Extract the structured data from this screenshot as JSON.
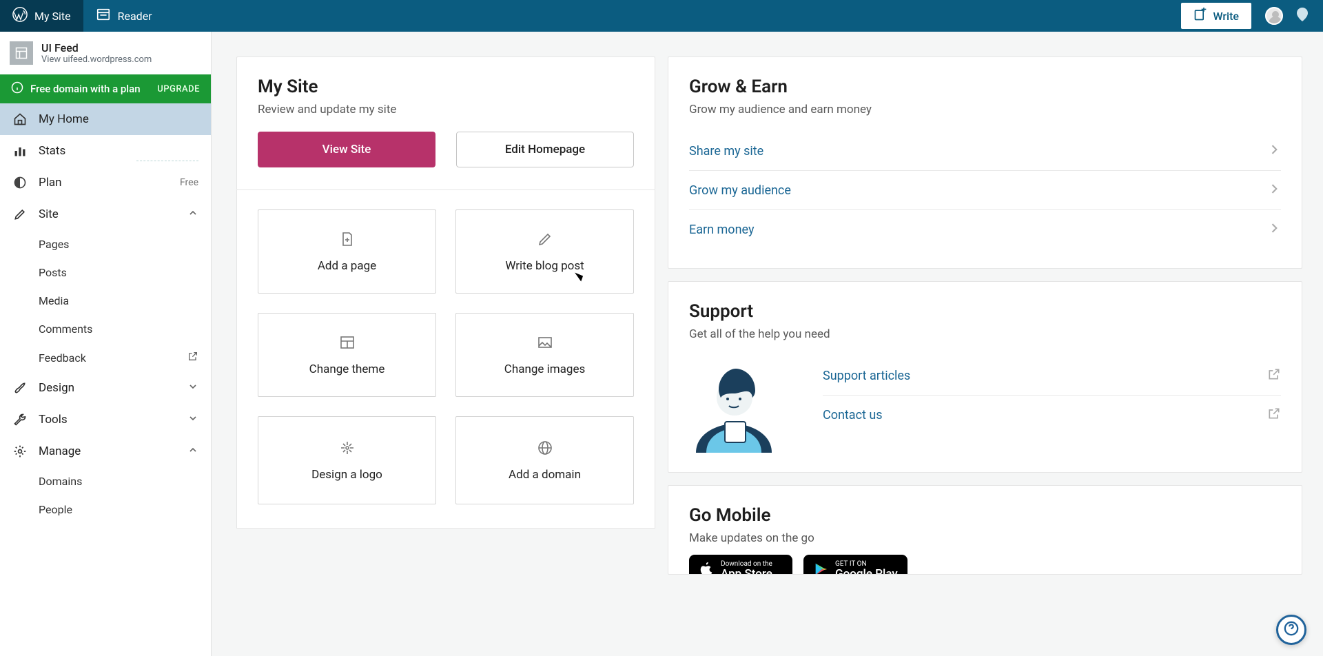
{
  "topbar": {
    "my_site": "My Site",
    "reader": "Reader",
    "write": "Write"
  },
  "sidebar": {
    "site_name": "UI Feed",
    "site_sub": "View uifeed.wordpress.com",
    "upgrade_label": "Free domain with a plan",
    "upgrade_cta": "UPGRADE",
    "nav": {
      "home": "My Home",
      "stats": "Stats",
      "plan": "Plan",
      "plan_extra": "Free",
      "site": "Site",
      "design": "Design",
      "tools": "Tools",
      "manage": "Manage"
    },
    "site_sub_items": [
      "Pages",
      "Posts",
      "Media",
      "Comments",
      "Feedback"
    ],
    "manage_sub_items": [
      "Domains",
      "People"
    ]
  },
  "mysite_card": {
    "title": "My Site",
    "desc": "Review and update my site",
    "view_btn": "View Site",
    "edit_btn": "Edit Homepage",
    "tiles": [
      "Add a page",
      "Write blog post",
      "Change theme",
      "Change images",
      "Design a logo",
      "Add a domain"
    ]
  },
  "grow_card": {
    "title": "Grow & Earn",
    "desc": "Grow my audience and earn money",
    "links": [
      "Share my site",
      "Grow my audience",
      "Earn money"
    ]
  },
  "support_card": {
    "title": "Support",
    "desc": "Get all of the help you need",
    "links": [
      "Support articles",
      "Contact us"
    ]
  },
  "mobile_card": {
    "title": "Go Mobile",
    "desc": "Make updates on the go",
    "appstore_sm": "Download on the",
    "appstore_lg": "App Store",
    "play_sm": "GET IT ON",
    "play_lg": "Google Play"
  }
}
